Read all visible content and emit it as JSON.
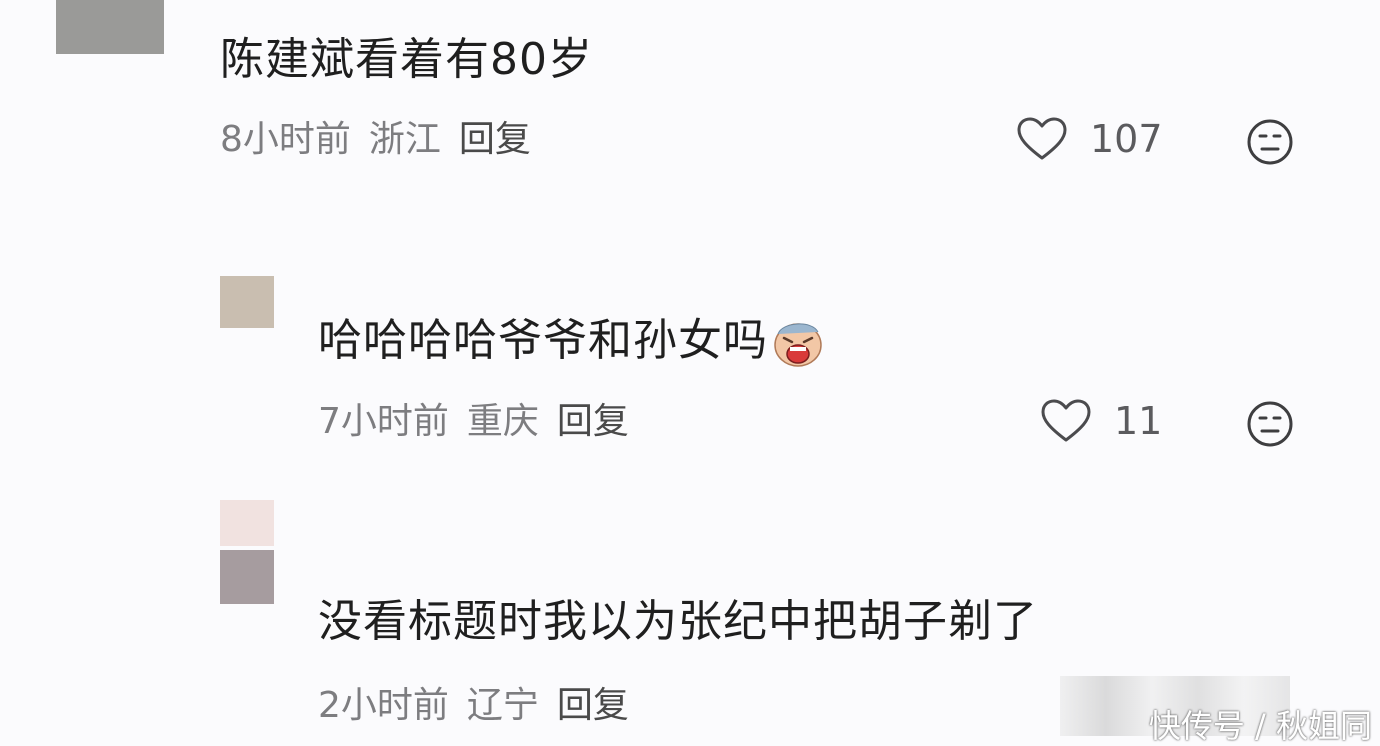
{
  "comments": [
    {
      "text": "陈建斌看着有80岁",
      "time": "8小时前",
      "location": "浙江",
      "reply": "回复",
      "likes": "107"
    },
    {
      "text": "哈哈哈哈爷爷和孙女吗",
      "time": "7小时前",
      "location": "重庆",
      "reply": "回复",
      "likes": "11",
      "emoji": "laughing-crying-emoji"
    },
    {
      "text": "没看标题时我以为张纪中把胡子剃了",
      "time": "2小时前",
      "location": "辽宁",
      "reply": "回复"
    }
  ],
  "watermark": "快传号 / 秋姐同",
  "icons": {
    "like": "heart-outline-icon",
    "dislike": "neutral-face-icon"
  },
  "colors": {
    "background": "#fbfbfd",
    "meta": "#7d7d80",
    "text": "#1f1f1f"
  }
}
